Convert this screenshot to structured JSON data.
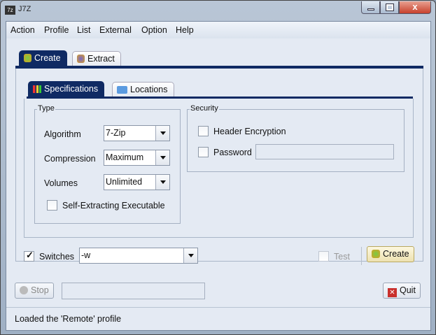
{
  "window": {
    "title": "J7Z",
    "icon_text": "7z"
  },
  "menu": [
    "Action",
    "Profile",
    "List",
    "External",
    "Option",
    "Help"
  ],
  "outer_tabs": [
    {
      "label": "Create",
      "selected": true
    },
    {
      "label": "Extract",
      "selected": false
    }
  ],
  "inner_tabs": [
    {
      "label": "Specifications",
      "selected": true
    },
    {
      "label": "Locations",
      "selected": false
    }
  ],
  "type_group": {
    "title": "Type",
    "algorithm_label": "Algorithm",
    "algorithm": "7-Zip",
    "compression_label": "Compression",
    "compression": "Maximum",
    "volumes_label": "Volumes",
    "volumes": "Unlimited",
    "sfx_label": "Self-Extracting Executable",
    "sfx_checked": false
  },
  "security_group": {
    "title": "Security",
    "header_encryption_label": "Header Encryption",
    "header_encryption_checked": false,
    "password_label": "Password",
    "password_value": ""
  },
  "switches": {
    "label": "Switches",
    "checked": true,
    "value": "-w"
  },
  "test": {
    "label": "Test",
    "checked": false
  },
  "create_button": "Create",
  "stop_button": "Stop",
  "progress_text": "",
  "quit_button": "Quit",
  "status": "Loaded the 'Remote' profile"
}
